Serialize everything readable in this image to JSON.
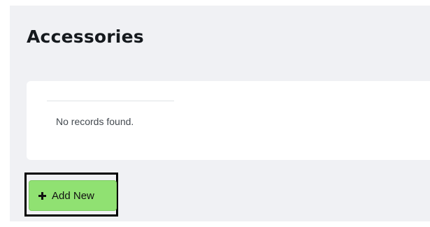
{
  "page": {
    "title": "Accessories"
  },
  "records_table": {
    "empty_message": "No records found."
  },
  "actions": {
    "add_new_label": "Add New",
    "add_new_icon": "plus-icon",
    "add_new_color": "#90e172",
    "highlight_color": "#000000"
  }
}
